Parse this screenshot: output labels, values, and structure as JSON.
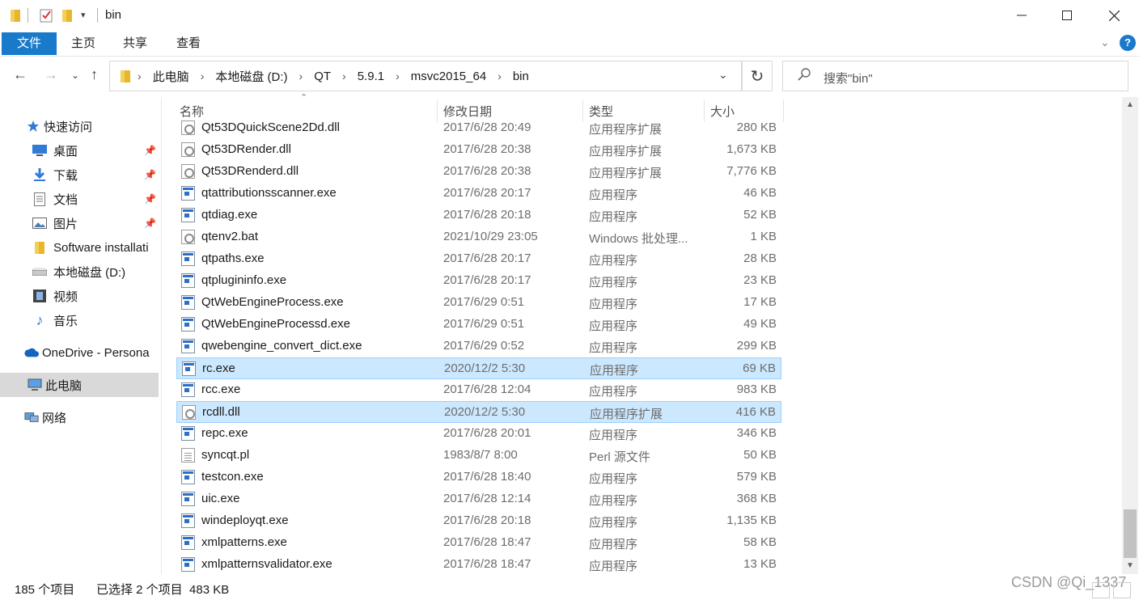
{
  "title": "bin",
  "ribbon": {
    "tabs": [
      "文件",
      "主页",
      "共享",
      "查看"
    ]
  },
  "breadcrumbs": [
    "此电脑",
    "本地磁盘 (D:)",
    "QT",
    "5.9.1",
    "msvc2015_64",
    "bin"
  ],
  "search": {
    "placeholder": "搜索\"bin\""
  },
  "nav": {
    "quick_access": "快速访问",
    "items": [
      {
        "label": "桌面",
        "icon": "desktop-icon",
        "pinned": true
      },
      {
        "label": "下载",
        "icon": "download-icon",
        "pinned": true
      },
      {
        "label": "文档",
        "icon": "document-icon",
        "pinned": true
      },
      {
        "label": "图片",
        "icon": "picture-icon",
        "pinned": true
      },
      {
        "label": "Software installati",
        "icon": "folder-icon",
        "pinned": false
      },
      {
        "label": "本地磁盘 (D:)",
        "icon": "drive-icon",
        "pinned": false
      },
      {
        "label": "视频",
        "icon": "video-icon",
        "pinned": false
      },
      {
        "label": "音乐",
        "icon": "music-icon",
        "pinned": false
      }
    ],
    "onedrive": "OneDrive - Persona",
    "this_pc": "此电脑",
    "network": "网络"
  },
  "columns": {
    "name": "名称",
    "date": "修改日期",
    "type": "类型",
    "size": "大小"
  },
  "files": [
    {
      "name": "Qt53DQuickScene2Dd.dll",
      "date": "2017/6/28 20:49",
      "type": "应用程序扩展",
      "size": "280 KB",
      "kind": "dll",
      "selected": false
    },
    {
      "name": "Qt53DRender.dll",
      "date": "2017/6/28 20:38",
      "type": "应用程序扩展",
      "size": "1,673 KB",
      "kind": "dll",
      "selected": false
    },
    {
      "name": "Qt53DRenderd.dll",
      "date": "2017/6/28 20:38",
      "type": "应用程序扩展",
      "size": "7,776 KB",
      "kind": "dll",
      "selected": false
    },
    {
      "name": "qtattributionsscanner.exe",
      "date": "2017/6/28 20:17",
      "type": "应用程序",
      "size": "46 KB",
      "kind": "exe",
      "selected": false
    },
    {
      "name": "qtdiag.exe",
      "date": "2017/6/28 20:18",
      "type": "应用程序",
      "size": "52 KB",
      "kind": "exe",
      "selected": false
    },
    {
      "name": "qtenv2.bat",
      "date": "2021/10/29 23:05",
      "type": "Windows 批处理...",
      "size": "1 KB",
      "kind": "bat",
      "selected": false
    },
    {
      "name": "qtpaths.exe",
      "date": "2017/6/28 20:17",
      "type": "应用程序",
      "size": "28 KB",
      "kind": "exe",
      "selected": false
    },
    {
      "name": "qtplugininfo.exe",
      "date": "2017/6/28 20:17",
      "type": "应用程序",
      "size": "23 KB",
      "kind": "exe",
      "selected": false
    },
    {
      "name": "QtWebEngineProcess.exe",
      "date": "2017/6/29 0:51",
      "type": "应用程序",
      "size": "17 KB",
      "kind": "exe",
      "selected": false
    },
    {
      "name": "QtWebEngineProcessd.exe",
      "date": "2017/6/29 0:51",
      "type": "应用程序",
      "size": "49 KB",
      "kind": "exe",
      "selected": false
    },
    {
      "name": "qwebengine_convert_dict.exe",
      "date": "2017/6/29 0:52",
      "type": "应用程序",
      "size": "299 KB",
      "kind": "exe",
      "selected": false
    },
    {
      "name": "rc.exe",
      "date": "2020/12/2 5:30",
      "type": "应用程序",
      "size": "69 KB",
      "kind": "exe",
      "selected": true
    },
    {
      "name": "rcc.exe",
      "date": "2017/6/28 12:04",
      "type": "应用程序",
      "size": "983 KB",
      "kind": "exe",
      "selected": false
    },
    {
      "name": "rcdll.dll",
      "date": "2020/12/2 5:30",
      "type": "应用程序扩展",
      "size": "416 KB",
      "kind": "dll",
      "selected": true
    },
    {
      "name": "repc.exe",
      "date": "2017/6/28 20:01",
      "type": "应用程序",
      "size": "346 KB",
      "kind": "exe",
      "selected": false
    },
    {
      "name": "syncqt.pl",
      "date": "1983/8/7 8:00",
      "type": "Perl 源文件",
      "size": "50 KB",
      "kind": "txt",
      "selected": false
    },
    {
      "name": "testcon.exe",
      "date": "2017/6/28 18:40",
      "type": "应用程序",
      "size": "579 KB",
      "kind": "exe",
      "selected": false
    },
    {
      "name": "uic.exe",
      "date": "2017/6/28 12:14",
      "type": "应用程序",
      "size": "368 KB",
      "kind": "exe",
      "selected": false
    },
    {
      "name": "windeployqt.exe",
      "date": "2017/6/28 20:18",
      "type": "应用程序",
      "size": "1,135 KB",
      "kind": "exe",
      "selected": false
    },
    {
      "name": "xmlpatterns.exe",
      "date": "2017/6/28 18:47",
      "type": "应用程序",
      "size": "58 KB",
      "kind": "exe",
      "selected": false
    },
    {
      "name": "xmlpatternsvalidator.exe",
      "date": "2017/6/28 18:47",
      "type": "应用程序",
      "size": "13 KB",
      "kind": "exe",
      "selected": false
    }
  ],
  "status": {
    "count": "185 个项目",
    "selected": "已选择 2 个项目  483 KB"
  },
  "watermark": "CSDN @Qi_1337",
  "colors": {
    "accent": "#1979ca",
    "selection": "#cce8ff",
    "selection_border": "#99d1ff"
  }
}
